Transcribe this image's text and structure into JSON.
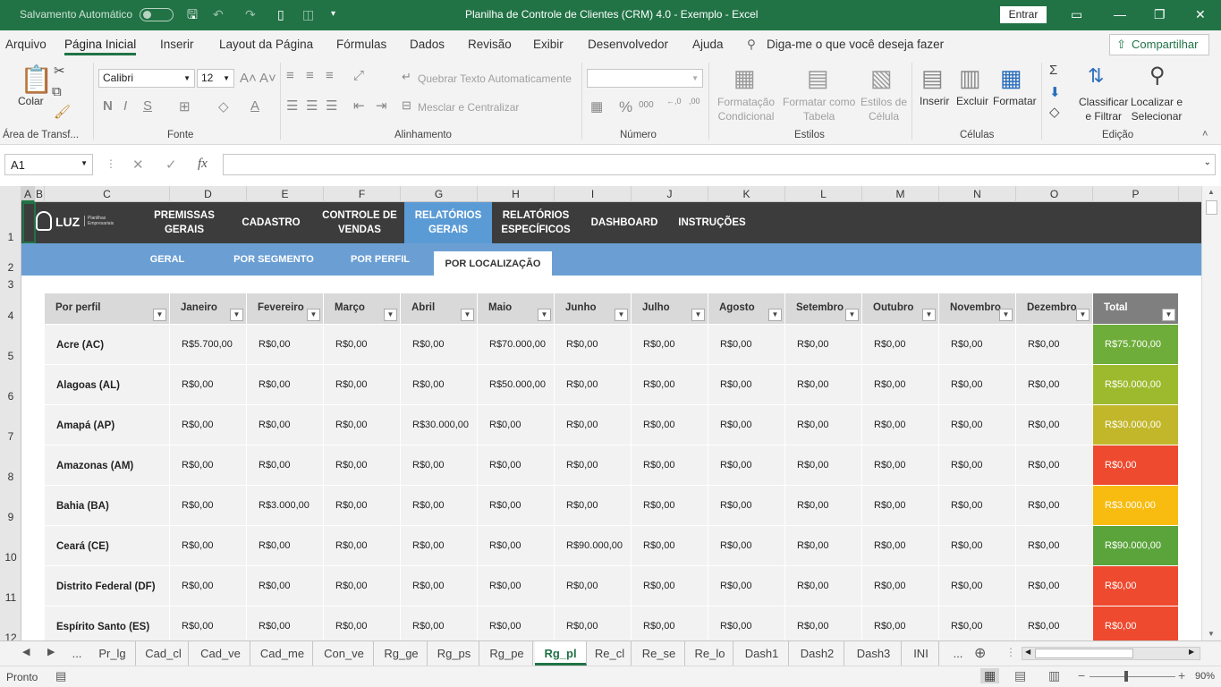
{
  "titlebar": {
    "autosave": "Salvamento Automático",
    "title": "Planilha de Controle de Clientes (CRM) 4.0 - Exemplo  -  Excel",
    "signin": "Entrar"
  },
  "menu": [
    "Arquivo",
    "Página Inicial",
    "Inserir",
    "Layout da Página",
    "Fórmulas",
    "Dados",
    "Revisão",
    "Exibir",
    "Desenvolvedor",
    "Ajuda"
  ],
  "tellme": "Diga-me o que você deseja fazer",
  "share": "Compartilhar",
  "ribbon": {
    "paste": "Colar",
    "font_name": "Calibri",
    "font_size": "12",
    "wrap_text": "Quebrar Texto Automaticamente",
    "merge": "Mesclar e Centralizar",
    "cond_format": "Formatação\nCondicional",
    "format_table": "Formatar como\nTabela",
    "cell_styles": "Estilos de\nCélula",
    "insert": "Inserir",
    "delete": "Excluir",
    "format": "Formatar",
    "sort_filter": "Classificar\ne Filtrar",
    "find_select": "Localizar e\nSelecionar",
    "groups": [
      "Área de Transf...",
      "Fonte",
      "Alinhamento",
      "Número",
      "Estilos",
      "Células",
      "Edição"
    ]
  },
  "formula": {
    "namebox": "A1",
    "fx": "fx",
    "content": ""
  },
  "columns": [
    "A",
    "B",
    "C",
    "D",
    "E",
    "F",
    "G",
    "H",
    "I",
    "J",
    "K",
    "L",
    "M",
    "N",
    "O",
    "P"
  ],
  "rows": [
    "1",
    "2",
    "3",
    "4",
    "5",
    "6",
    "7",
    "8",
    "9",
    "10",
    "11",
    "12"
  ],
  "logo": {
    "text": "LUZ",
    "sub": "Planilhas\nEmpresariais"
  },
  "nav": [
    "PREMISSAS\nGERAIS",
    "CADASTRO",
    "CONTROLE DE\nVENDAS",
    "RELATÓRIOS\nGERAIS",
    "RELATÓRIOS\nESPECÍFICOS",
    "DASHBOARD",
    "INSTRUÇÕES"
  ],
  "subnav": [
    "GERAL",
    "POR SEGMENTO",
    "POR PERFIL",
    "POR LOCALIZAÇÃO"
  ],
  "table": {
    "headers": [
      "Por perfil",
      "Janeiro",
      "Fevereiro",
      "Março",
      "Abril",
      "Maio",
      "Junho",
      "Julho",
      "Agosto",
      "Setembro",
      "Outubro",
      "Novembro",
      "Dezembro",
      "Total"
    ],
    "rows": [
      {
        "name": "Acre (AC)",
        "values": [
          "R$5.700,00",
          "R$0,00",
          "R$0,00",
          "R$0,00",
          "R$70.000,00",
          "R$0,00",
          "R$0,00",
          "R$0,00",
          "R$0,00",
          "R$0,00",
          "R$0,00",
          "R$0,00"
        ],
        "total": "R$75.700,00",
        "color": "#6fad3b"
      },
      {
        "name": "Alagoas (AL)",
        "values": [
          "R$0,00",
          "R$0,00",
          "R$0,00",
          "R$0,00",
          "R$50.000,00",
          "R$0,00",
          "R$0,00",
          "R$0,00",
          "R$0,00",
          "R$0,00",
          "R$0,00",
          "R$0,00"
        ],
        "total": "R$50.000,00",
        "color": "#9dba2e"
      },
      {
        "name": "Amapá (AP)",
        "values": [
          "R$0,00",
          "R$0,00",
          "R$0,00",
          "R$30.000,00",
          "R$0,00",
          "R$0,00",
          "R$0,00",
          "R$0,00",
          "R$0,00",
          "R$0,00",
          "R$0,00",
          "R$0,00"
        ],
        "total": "R$30.000,00",
        "color": "#c2b72b"
      },
      {
        "name": "Amazonas (AM)",
        "values": [
          "R$0,00",
          "R$0,00",
          "R$0,00",
          "R$0,00",
          "R$0,00",
          "R$0,00",
          "R$0,00",
          "R$0,00",
          "R$0,00",
          "R$0,00",
          "R$0,00",
          "R$0,00"
        ],
        "total": "R$0,00",
        "color": "#ee4a2f"
      },
      {
        "name": "Bahia (BA)",
        "values": [
          "R$0,00",
          "R$3.000,00",
          "R$0,00",
          "R$0,00",
          "R$0,00",
          "R$0,00",
          "R$0,00",
          "R$0,00",
          "R$0,00",
          "R$0,00",
          "R$0,00",
          "R$0,00"
        ],
        "total": "R$3.000,00",
        "color": "#f8bc10"
      },
      {
        "name": "Ceará (CE)",
        "values": [
          "R$0,00",
          "R$0,00",
          "R$0,00",
          "R$0,00",
          "R$0,00",
          "R$90.000,00",
          "R$0,00",
          "R$0,00",
          "R$0,00",
          "R$0,00",
          "R$0,00",
          "R$0,00"
        ],
        "total": "R$90.000,00",
        "color": "#5ba43c"
      },
      {
        "name": "Distrito Federal (DF)",
        "values": [
          "R$0,00",
          "R$0,00",
          "R$0,00",
          "R$0,00",
          "R$0,00",
          "R$0,00",
          "R$0,00",
          "R$0,00",
          "R$0,00",
          "R$0,00",
          "R$0,00",
          "R$0,00"
        ],
        "total": "R$0,00",
        "color": "#ee4a2f"
      },
      {
        "name": "Espírito Santo (ES)",
        "values": [
          "R$0,00",
          "R$0,00",
          "R$0,00",
          "R$0,00",
          "R$0,00",
          "R$0,00",
          "R$0,00",
          "R$0,00",
          "R$0,00",
          "R$0,00",
          "R$0,00",
          "R$0,00"
        ],
        "total": "R$0,00",
        "color": "#ee4a2f"
      }
    ]
  },
  "tabs": [
    "...",
    "Pr_lg",
    "Cad_cl",
    "Cad_ve",
    "Cad_me",
    "Con_ve",
    "Rg_ge",
    "Rg_ps",
    "Rg_pe",
    "Rg_pl",
    "Re_cl",
    "Re_se",
    "Re_lo",
    "Dash1",
    "Dash2",
    "Dash3",
    "INI",
    "..."
  ],
  "active_tab": "Rg_pl",
  "status": {
    "ready": "Pronto",
    "zoom": "90%"
  }
}
